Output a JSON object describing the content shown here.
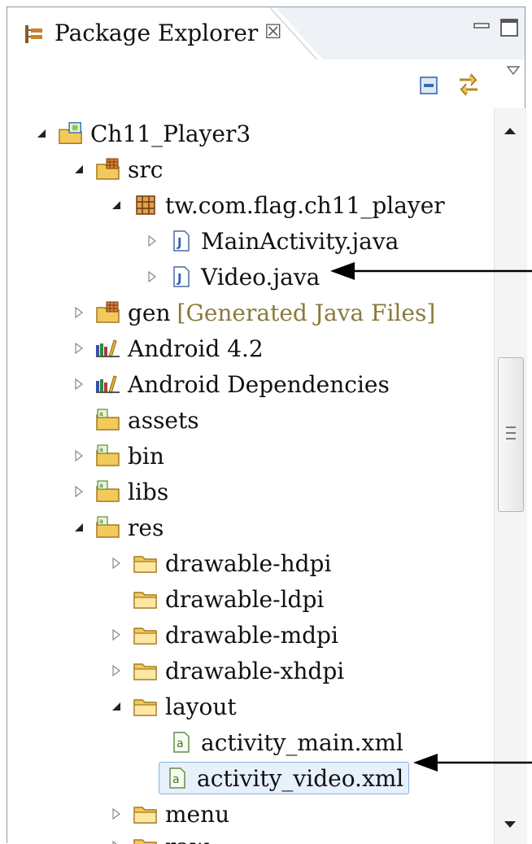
{
  "view": {
    "title": "Package Explorer",
    "close_glyph": "☒",
    "icon": "package-explorer-icon"
  },
  "toolbar": {
    "collapse_all": "collapse-all-icon",
    "link_with_editor": "link-with-editor-icon",
    "view_menu": "view-menu-icon"
  },
  "tree": {
    "project": "Ch11_Player3",
    "src": "src",
    "package": "tw.com.flag.ch11_player",
    "main_activity": "MainActivity.java",
    "video_java": "Video.java",
    "gen": "gen",
    "gen_decoration": "[Generated Java Files]",
    "android": "Android 4.2",
    "android_deps": "Android Dependencies",
    "assets": "assets",
    "bin": "bin",
    "libs": "libs",
    "res": "res",
    "drawable_hdpi": "drawable-hdpi",
    "drawable_ldpi": "drawable-ldpi",
    "drawable_mdpi": "drawable-mdpi",
    "drawable_xhdpi": "drawable-xhdpi",
    "layout": "layout",
    "activity_main": "activity_main.xml",
    "activity_video": "activity_video.xml",
    "menu": "menu",
    "raw": "raw"
  },
  "colors": {
    "selection_border": "#86b3e0",
    "selection_fill": "#e6f1fb",
    "decoration_text": "#8a7a3a",
    "folder_yellow": "#f3c95b",
    "java_blue": "#2c62b9"
  }
}
